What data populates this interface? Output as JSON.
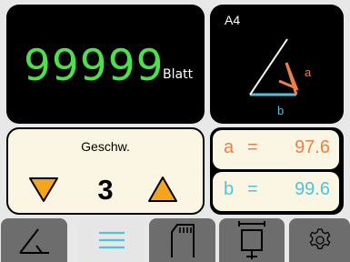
{
  "counter": {
    "value": "99999",
    "unit": "Blatt",
    "color": "#4ee04a"
  },
  "format": {
    "label": "A4",
    "side_a": "a",
    "side_b": "b",
    "color_a": "#ef7f45",
    "color_b": "#4fc3d9"
  },
  "speed": {
    "label": "Geschw.",
    "value": "3",
    "arrow_color": "#f5a51c"
  },
  "angles": {
    "a": {
      "name": "a",
      "eq": "=",
      "value": "97.6",
      "color": "#ef7f45"
    },
    "b": {
      "name": "b",
      "eq": "=",
      "value": "99.6",
      "color": "#4fc3d9"
    }
  },
  "tabs": [
    {
      "icon": "angle-icon",
      "active": false
    },
    {
      "icon": "menu-icon",
      "active": true
    },
    {
      "icon": "sd-card-icon",
      "active": false
    },
    {
      "icon": "paper-size-icon",
      "active": false
    },
    {
      "icon": "gear-icon",
      "active": false
    }
  ],
  "colors": {
    "tab_inactive": "#6d6d6d",
    "tab_active": "#e6e6e6",
    "active_icon": "#4fc3d9",
    "inactive_icon": "#000000"
  }
}
